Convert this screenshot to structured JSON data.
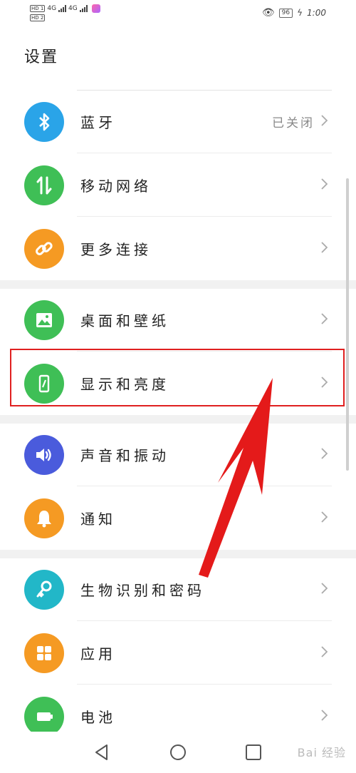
{
  "status_bar": {
    "sim1": "HD 1",
    "sim2": "HD 2",
    "network1": "4G",
    "network2": "4G",
    "battery": "96",
    "time": "1:00"
  },
  "page": {
    "title": "设置"
  },
  "settings": [
    {
      "label": "蓝牙",
      "value": "已关闭",
      "icon": "bluetooth-icon",
      "color": "#2aa4e8"
    },
    {
      "label": "移动网络",
      "value": "",
      "icon": "mobile-network-icon",
      "color": "#3fbf56"
    },
    {
      "label": "更多连接",
      "value": "",
      "icon": "link-icon",
      "color": "#f59a23"
    },
    {
      "label": "桌面和壁纸",
      "value": "",
      "icon": "wallpaper-icon",
      "color": "#3fbf56"
    },
    {
      "label": "显示和亮度",
      "value": "",
      "icon": "display-icon",
      "color": "#3fbf56"
    },
    {
      "label": "声音和振动",
      "value": "",
      "icon": "sound-icon",
      "color": "#4a5bdc"
    },
    {
      "label": "通知",
      "value": "",
      "icon": "bell-icon",
      "color": "#f59a23"
    },
    {
      "label": "生物识别和密码",
      "value": "",
      "icon": "key-icon",
      "color": "#22b7c8"
    },
    {
      "label": "应用",
      "value": "",
      "icon": "apps-icon",
      "color": "#f59a23"
    },
    {
      "label": "电池",
      "value": "",
      "icon": "battery-icon",
      "color": "#3fbf56"
    }
  ],
  "annotation": {
    "color": "#e02020"
  },
  "watermark": {
    "text": "Bai 经验"
  }
}
